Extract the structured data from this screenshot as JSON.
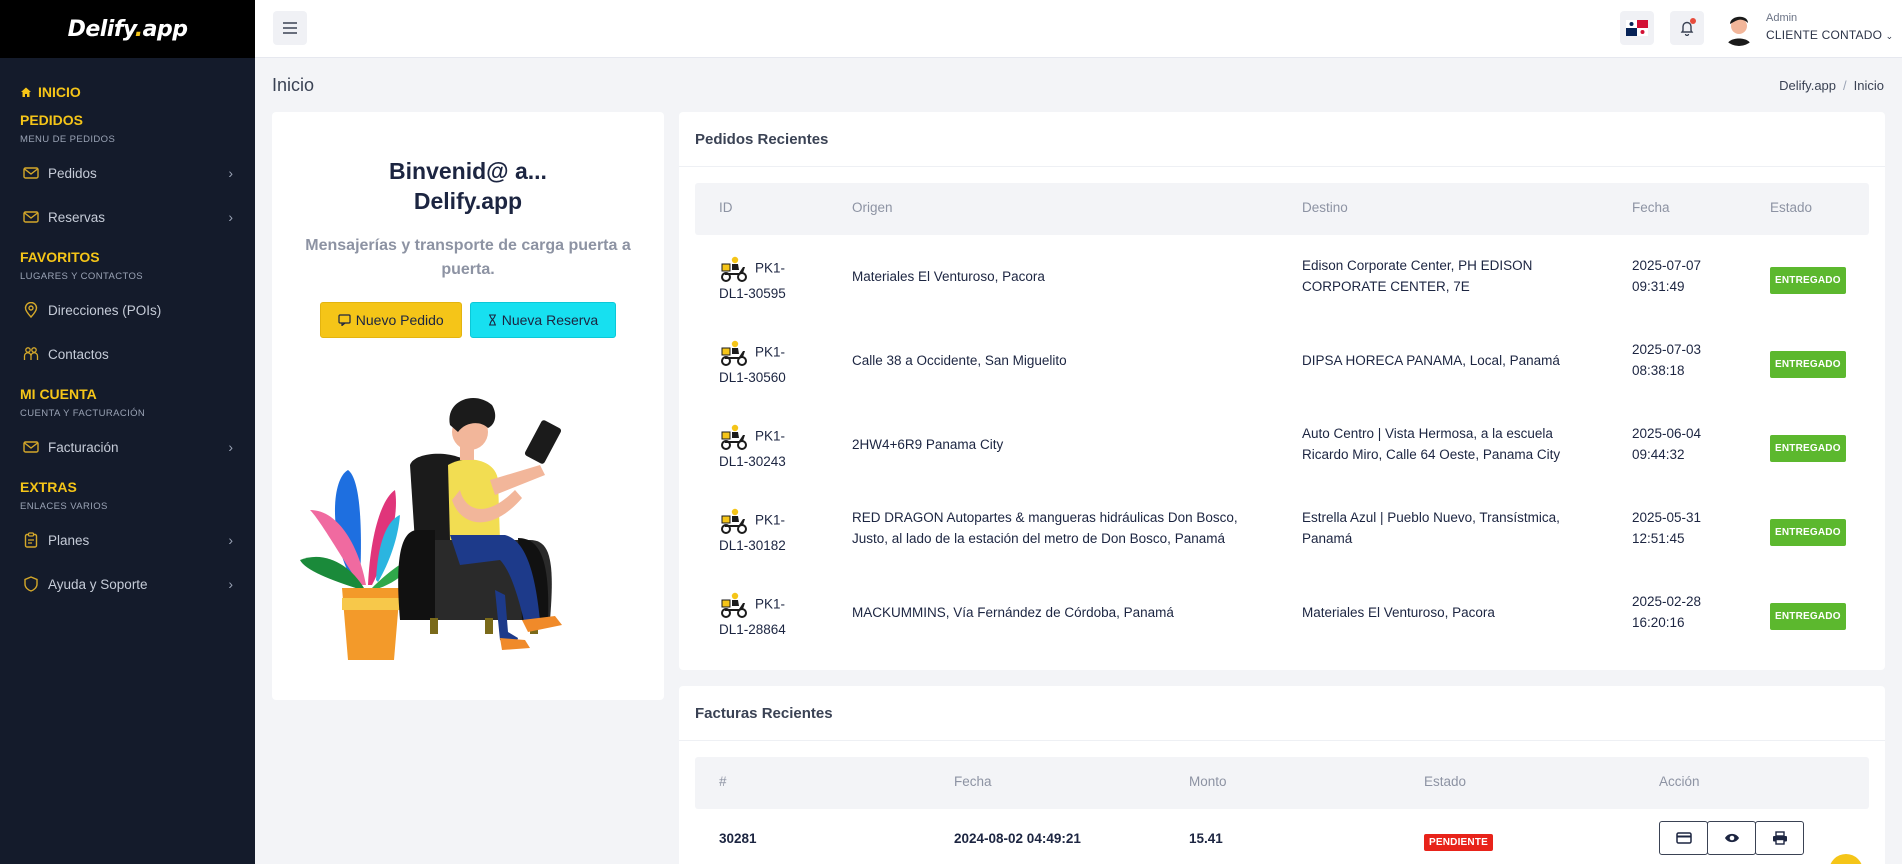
{
  "brand": {
    "logo_main": "Delify",
    "logo_dot": ".",
    "logo_tld": "app"
  },
  "sidebar": {
    "home": "INICIO",
    "sections": [
      {
        "title": "PEDIDOS",
        "subtitle": "MENU DE PEDIDOS",
        "items": [
          {
            "label": "Pedidos",
            "icon": "envelope-icon"
          },
          {
            "label": "Reservas",
            "icon": "envelope-icon"
          }
        ]
      },
      {
        "title": "FAVORITOS",
        "subtitle": "LUGARES Y CONTACTOS",
        "items": [
          {
            "label": "Direcciones (POIs)",
            "icon": "map-pin-icon"
          },
          {
            "label": "Contactos",
            "icon": "users-icon"
          }
        ]
      },
      {
        "title": "MI CUENTA",
        "subtitle": "CUENTA Y FACTURACIÓN",
        "items": [
          {
            "label": "Facturación",
            "icon": "envelope-icon"
          }
        ]
      },
      {
        "title": "EXTRAS",
        "subtitle": "ENLACES VARIOS",
        "items": [
          {
            "label": "Planes",
            "icon": "clipboard-icon"
          },
          {
            "label": "Ayuda y Soporte",
            "icon": "shield-icon"
          }
        ]
      }
    ]
  },
  "topbar": {
    "user_role": "Admin",
    "user_name": "CLIENTE CONTADO"
  },
  "page": {
    "title": "Inicio",
    "breadcrumb": [
      "Delify.app",
      "Inicio"
    ]
  },
  "welcome": {
    "title_line1": "Binvenid@ a...",
    "title_line2": "Delify.app",
    "subtitle": "Mensajerías y transporte de carga puerta a puerta.",
    "btn_new_order": "Nuevo Pedido",
    "btn_new_booking": "Nueva Reserva"
  },
  "orders": {
    "title": "Pedidos Recientes",
    "headers": {
      "id": "ID",
      "origin": "Origen",
      "dest": "Destino",
      "date": "Fecha",
      "status": "Estado"
    },
    "rows": [
      {
        "id1": "PK1-",
        "id2": "DL1-30595",
        "origin": "Materiales El Venturoso, Pacora",
        "dest": "Edison Corporate Center, PH EDISON CORPORATE CENTER, 7E",
        "date": "2025-07-07",
        "time": "09:31:49",
        "status": "ENTREGADO"
      },
      {
        "id1": "PK1-",
        "id2": "DL1-30560",
        "origin": "Calle 38 a Occidente, San Miguelito",
        "dest": "DIPSA HORECA PANAMA, Local, Panamá",
        "date": "2025-07-03",
        "time": "08:38:18",
        "status": "ENTREGADO"
      },
      {
        "id1": "PK1-",
        "id2": "DL1-30243",
        "origin": "2HW4+6R9 Panama City",
        "dest": "Auto Centro | Vista Hermosa, a la escuela Ricardo Miro, Calle 64 Oeste, Panama City",
        "date": "2025-06-04",
        "time": "09:44:32",
        "status": "ENTREGADO"
      },
      {
        "id1": "PK1-",
        "id2": "DL1-30182",
        "origin": "RED DRAGON Autopartes & mangueras hidráulicas Don Bosco, Justo, al lado de la estación del metro de Don Bosco, Panamá",
        "dest": "Estrella Azul | Pueblo Nuevo, Transístmica, Panamá",
        "date": "2025-05-31",
        "time": "12:51:45",
        "status": "ENTREGADO"
      },
      {
        "id1": "PK1-",
        "id2": "DL1-28864",
        "origin": "MACKUMMINS, Vía Fernández de Córdoba, Panamá",
        "dest": "Materiales El Venturoso, Pacora",
        "date": "2025-02-28",
        "time": "16:20:16",
        "status": "ENTREGADO"
      }
    ]
  },
  "invoices": {
    "title": "Facturas Recientes",
    "headers": {
      "num": "#",
      "date": "Fecha",
      "amount": "Monto",
      "status": "Estado",
      "action": "Acción"
    },
    "rows": [
      {
        "num": "30281",
        "date": "2024-08-02 04:49:21",
        "amount": "15.41",
        "status": "PENDIENTE"
      }
    ]
  },
  "colors": {
    "accent": "#f5c518",
    "sidebar_bg": "#141b2b",
    "success": "#5cb82e",
    "danger": "#e8231a",
    "cyan": "#17e0f0"
  }
}
